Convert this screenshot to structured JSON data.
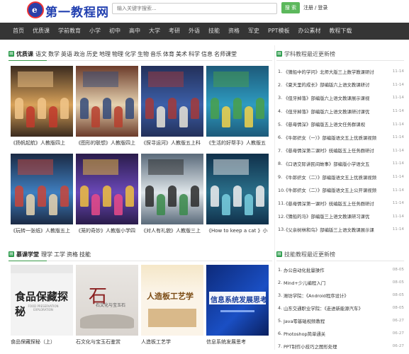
{
  "header": {
    "logo_mark": "e",
    "logo_text": "第一教程网",
    "search_placeholder": "输入关键字搜索...",
    "search_button": "搜 索",
    "register": "注册",
    "login_sep": "/",
    "login": "登录"
  },
  "nav": [
    "首页",
    "优质课",
    "学前教育",
    "小学",
    "初中",
    "高中",
    "大学",
    "考研",
    "外语",
    "技能",
    "资格",
    "军史",
    "PPT模板",
    "办公素材",
    "教程下载"
  ],
  "sections": {
    "quality": {
      "title": "优质课",
      "links": [
        "语文",
        "数学",
        "英语",
        "政治",
        "历史",
        "地理",
        "物理",
        "化学",
        "生物",
        "音乐",
        "体育",
        "美术",
        "科学",
        "信息",
        "名师课堂"
      ],
      "thumbs": [
        {
          "caption": "《扬帆起航》人教版四上"
        },
        {
          "caption": "《图形的联想》人教版四上"
        },
        {
          "caption": "《探寻运河》人教版五上科"
        },
        {
          "caption": "《生活的好帮手》人教版五"
        },
        {
          "caption": "《玩转一张纸》人教版五上"
        },
        {
          "caption": "《笼的奇妙》人教版小学四"
        },
        {
          "caption": "《对人有礼貌》人教版三上"
        },
        {
          "caption": "《How to keep a cat 》小"
        }
      ]
    },
    "mooc": {
      "title": "慕课学堂",
      "links": [
        "理学",
        "工学",
        "资格",
        "技能"
      ],
      "thumbs": [
        {
          "caption": "食品保藏探秘（上）",
          "img_text": "食品保藏探秘",
          "img_sub": "FOOD PRESERVATION EXPLORATION"
        },
        {
          "caption": "石文化与宝玉石鉴赏",
          "img_text": "石文化与宝玉石"
        },
        {
          "caption": "人造板工艺学",
          "img_text": "人造板工艺学"
        },
        {
          "caption": "信息系统发展思考",
          "img_text": "信息系统发展思考"
        }
      ]
    }
  },
  "right_top": {
    "title": "学科教程最近更新榜",
    "items": [
      {
        "num": "1.",
        "text": "《猜船中的学问》北师大版三上数学教课研讨",
        "date": "11-14"
      },
      {
        "num": "2.",
        "text": "《夏天里的成长》部编版六上语文教课研讨",
        "date": "11-14"
      },
      {
        "num": "3.",
        "text": "《但牙掉落》部编版六上语文教课展示课视",
        "date": "11-14"
      },
      {
        "num": "4.",
        "text": "《但牙掉落》部编版六上语文教课研讨课优",
        "date": "11-14"
      },
      {
        "num": "5.",
        "text": "《慈母情深》部编版五上语文任务群课视",
        "date": "11-14"
      },
      {
        "num": "6.",
        "text": "《牛郎织女（一）》部编版语文五上优质课视频",
        "date": "11-14"
      },
      {
        "num": "7.",
        "text": "《慈母情深第二课时》统编版五上任务群研讨",
        "date": "11-14"
      },
      {
        "num": "8.",
        "text": "《口语交际讲民间故事》部编版小学语文五",
        "date": "11-14"
      },
      {
        "num": "9.",
        "text": "《牛郎织女（二）》部编版语文五上优质课视频",
        "date": "11-14"
      },
      {
        "num": "10.",
        "text": "《牛郎织女（二）》部编版语文五上公开课视频",
        "date": "11-14"
      },
      {
        "num": "11.",
        "text": "《慈母情深第一课时》统编版五上任务群研讨",
        "date": "11-14"
      },
      {
        "num": "12.",
        "text": "《猜船的马》部编版三上语文教课研习课优",
        "date": "11-14"
      },
      {
        "num": "13.",
        "text": "《父亲树林和鸟》部编版三上语文教课展示课",
        "date": "11-14"
      }
    ]
  },
  "right_bottom": {
    "title": "技能教程最近更新榜",
    "items": [
      {
        "num": "1.",
        "text": "办公自动化批量操作",
        "date": "08-05"
      },
      {
        "num": "2.",
        "text": "Mind+少儿编程入门",
        "date": "08-05"
      },
      {
        "num": "3.",
        "text": "潍坊学院：《Android程序设计》",
        "date": "08-05"
      },
      {
        "num": "4.",
        "text": "山东交通职业学院：《走进新能源汽车》",
        "date": "08-05"
      },
      {
        "num": "5.",
        "text": "Java零基础视频教程",
        "date": "06-27"
      },
      {
        "num": "6.",
        "text": "Photoshop简单通关",
        "date": "06-27"
      },
      {
        "num": "7.",
        "text": "PPT制作小技巧之图形处理",
        "date": "06-27"
      }
    ]
  },
  "colors": {
    "nav_bg": "#353535",
    "accent_green": "#5cb85c",
    "logo_blue": "#2240b0"
  }
}
